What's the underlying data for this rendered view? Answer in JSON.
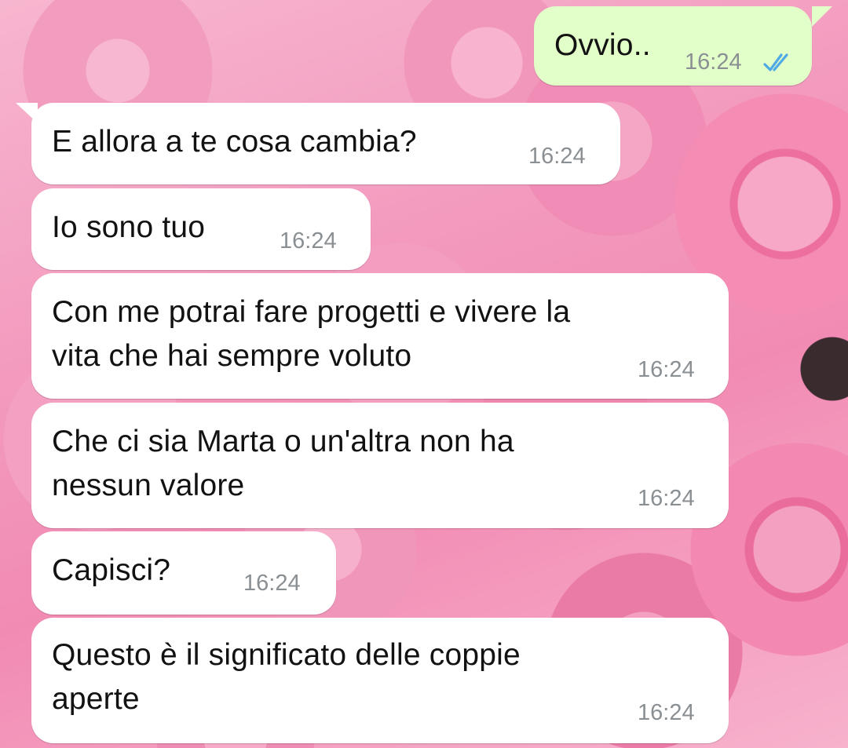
{
  "chat": {
    "messages": [
      {
        "direction": "outgoing",
        "text": "Ovvio..",
        "time": "16:24",
        "status": "read",
        "status_icon": "double-check-icon",
        "status_color": "#4fa9e6"
      },
      {
        "direction": "incoming",
        "text": "E allora a te cosa cambia?",
        "time": "16:24"
      },
      {
        "direction": "incoming",
        "text": "Io sono tuo",
        "time": "16:24"
      },
      {
        "direction": "incoming",
        "text": "Con me potrai fare progetti e vivere la\nvita che hai sempre voluto",
        "time": "16:24"
      },
      {
        "direction": "incoming",
        "text": "Che ci sia Marta o un'altra non ha\nnessun valore",
        "time": "16:24"
      },
      {
        "direction": "incoming",
        "text": "Capisci?",
        "time": "16:24"
      },
      {
        "direction": "incoming",
        "text": "Questo è il significato delle coppie\naperte",
        "time": "16:24"
      }
    ]
  },
  "colors": {
    "incoming_bubble": "#ffffff",
    "outgoing_bubble": "#e2fec9",
    "timestamp": "#8a8f93",
    "read_ticks": "#4fa9e6",
    "wallpaper": "pink roses"
  }
}
